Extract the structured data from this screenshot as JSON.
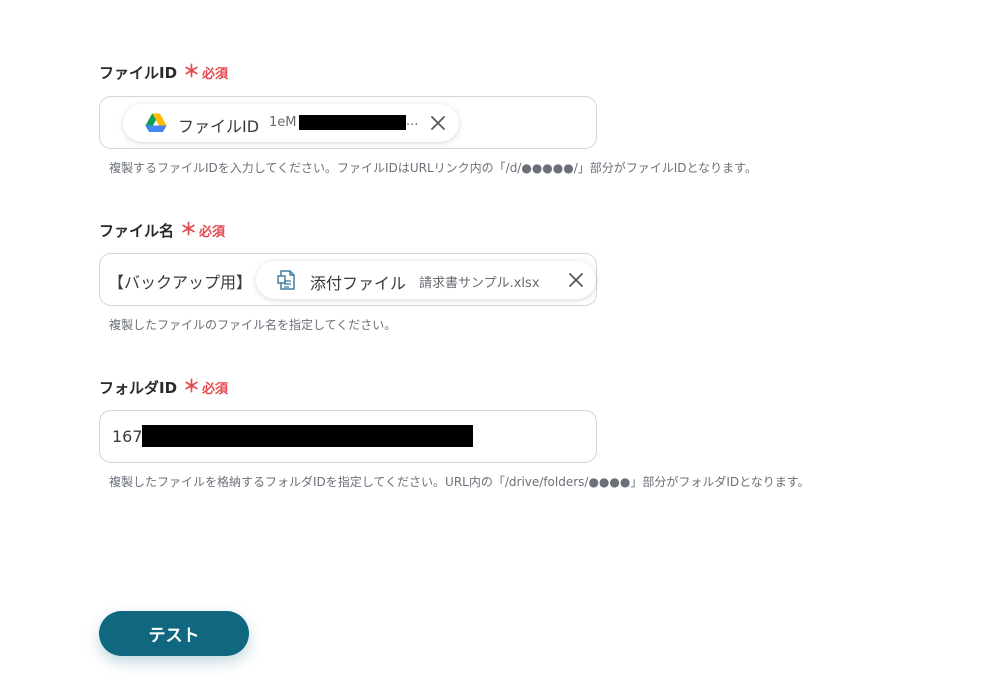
{
  "fields": [
    {
      "label": "ファイルID",
      "required_mark": "＊",
      "required_text": "必須",
      "chip": {
        "icon": "google-drive-icon",
        "name": "ファイルID",
        "value": "1eM"
      },
      "value_suffix": "...",
      "helper": "複製するファイルIDを入力してください。ファイルIDはURLリンク内の「/d/●●●●●/」部分がファイルIDとなります。"
    },
    {
      "label": "ファイル名",
      "required_mark": "＊",
      "required_text": "必須",
      "prefix_text": "【バックアップ用】",
      "chip": {
        "icon": "attachment-file-icon",
        "name": "添付ファイル",
        "value": "請求書サンプル.xlsx"
      },
      "helper": "複製したファイルのファイル名を指定してください。"
    },
    {
      "label": "フォルダID",
      "required_mark": "＊",
      "required_text": "必須",
      "value": "167",
      "helper": "複製したファイルを格納するフォルダIDを指定してください。URL内の「/drive/folders/●●●●」部分がフォルダIDとなります。"
    }
  ],
  "test_button": {
    "label": "テスト"
  },
  "colors": {
    "required": "#e5484d",
    "button": "#0f6880",
    "border": "#d2d5da",
    "helper_text": "#6b7078"
  }
}
